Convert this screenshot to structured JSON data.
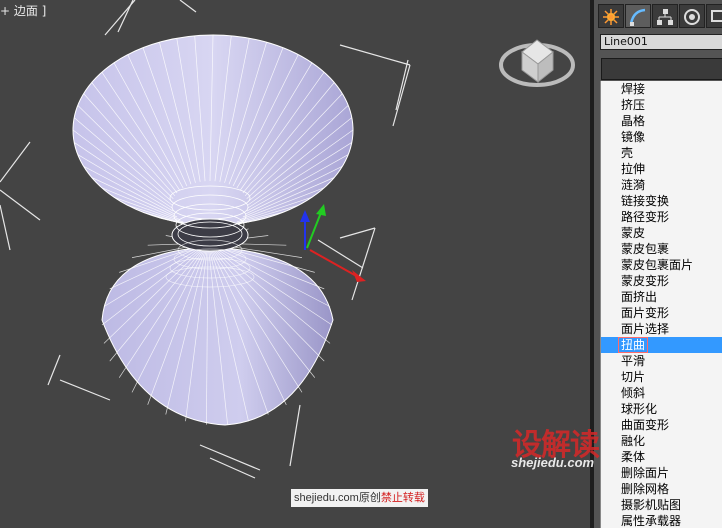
{
  "viewport": {
    "label": "+ 边面 ]",
    "background": "#444444",
    "mesh_color": "#b9b6e0"
  },
  "panel": {
    "tabs": [
      {
        "icon": "create-icon",
        "active": false
      },
      {
        "icon": "modify-icon",
        "active": true
      },
      {
        "icon": "hierarchy-icon",
        "active": false
      },
      {
        "icon": "motion-icon",
        "active": false
      },
      {
        "icon": "display-icon",
        "active": false
      }
    ],
    "object_name": "Line001",
    "modifiers": [
      "焊接",
      "挤压",
      "晶格",
      "镜像",
      "壳",
      "拉伸",
      "涟漪",
      "链接变换",
      "路径变形",
      "蒙皮",
      "蒙皮包裹",
      "蒙皮包裹面片",
      "蒙皮变形",
      "面挤出",
      "面片变形",
      "面片选择",
      "扭曲",
      "平滑",
      "切片",
      "倾斜",
      "球形化",
      "曲面变形",
      "融化",
      "柔体",
      "删除面片",
      "删除网格",
      "摄影机贴图",
      "属性承载器"
    ],
    "selected_index": 16,
    "accent": "#3399ff"
  },
  "watermark": {
    "logo": "设解读",
    "url": "shejiedu.com"
  },
  "credit": {
    "prefix": "shejiedu.com原创",
    "warning": "禁止转载"
  }
}
